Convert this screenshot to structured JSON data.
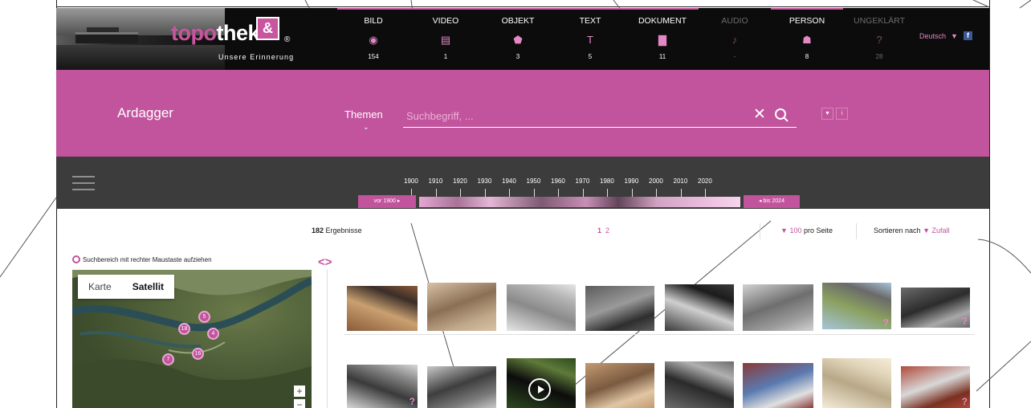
{
  "brand": {
    "word_a": "topo",
    "word_b": "thek",
    "mark": "&",
    "registered": "®",
    "tagline": "Unsere Erinnerung"
  },
  "categories": [
    {
      "label": "BILD",
      "icon": "image-icon",
      "glyph": "◉",
      "count": "154",
      "active": true
    },
    {
      "label": "VIDEO",
      "icon": "video-icon",
      "glyph": "▤",
      "count": "1",
      "active": true
    },
    {
      "label": "OBJEKT",
      "icon": "object-icon",
      "glyph": "⬟",
      "count": "3",
      "active": true
    },
    {
      "label": "TEXT",
      "icon": "text-icon",
      "glyph": "T",
      "count": "5",
      "active": true
    },
    {
      "label": "DOKUMENT",
      "icon": "document-icon",
      "glyph": "▇",
      "count": "11",
      "active": true
    },
    {
      "label": "AUDIO",
      "icon": "audio-icon",
      "glyph": "♪",
      "count": "-",
      "active": false
    },
    {
      "label": "PERSON",
      "icon": "person-icon",
      "glyph": "☗",
      "count": "8",
      "active": true
    },
    {
      "label": "UNGEKLÄRT",
      "icon": "question-icon",
      "glyph": "?",
      "count": "28",
      "active": false
    }
  ],
  "language": {
    "label": "Deutsch",
    "arrow": "▼"
  },
  "facebook": "f",
  "search": {
    "place": "Ardagger",
    "themen_label": "Themen",
    "themen_chevron": "⌄",
    "placeholder": "Suchbegriff, ...",
    "clear": "✕",
    "dropdown_btn": "▼",
    "info_btn": "i"
  },
  "timeline": {
    "years": [
      "1900",
      "1910",
      "1920",
      "1930",
      "1940",
      "1950",
      "1960",
      "1970",
      "1980",
      "1990",
      "2000",
      "2010",
      "2020"
    ],
    "start_label": "vor 1900",
    "end_label": "bis 2024"
  },
  "results": {
    "count": "182",
    "count_label": "Ergebnisse",
    "pages": [
      "1",
      "2"
    ],
    "current_page": "1",
    "per_page_arrow": "▼",
    "per_page_value": "100",
    "per_page_label": "pro Seite",
    "sort_label": "Sortieren nach",
    "sort_arrow": "▼",
    "sort_value": "Zufall"
  },
  "map": {
    "hint": "Suchbereich mit rechter Maustaste aufziehen",
    "toggle": "<>",
    "type_options": [
      "Karte",
      "Satellit"
    ],
    "selected_type": "Satellit",
    "clusters": [
      "5",
      "18",
      "4",
      "16",
      "7"
    ],
    "zoom_in": "+",
    "zoom_out": "−"
  },
  "thumbnails": {
    "row1": [
      {
        "name": "thumb-group-work-scene",
        "colors": [
          "#8a5a3a",
          "#c9a070",
          "#3a2e28"
        ]
      },
      {
        "name": "thumb-sepia-yard",
        "colors": [
          "#d8c2a4",
          "#8b6f55",
          "#bfa78a"
        ]
      },
      {
        "name": "thumb-street-village",
        "colors": [
          "#e6e6e6",
          "#8a8a8a",
          "#b4b4b4"
        ]
      },
      {
        "name": "thumb-aerial-view",
        "colors": [
          "#5c5c5c",
          "#9a9a9a",
          "#2e2e2e"
        ]
      },
      {
        "name": "thumb-house-trees",
        "colors": [
          "#3a3a3a",
          "#cfcfcf",
          "#1c1c1c"
        ]
      },
      {
        "name": "thumb-church-postcard",
        "colors": [
          "#d2d2d2",
          "#6e6e6e",
          "#9c9c9c"
        ]
      },
      {
        "name": "thumb-wayside-shrine",
        "colors": [
          "#a7c4d9",
          "#8aa060",
          "#6a6a6a"
        ],
        "unresolved": true
      },
      {
        "name": "thumb-group-photo-bw",
        "colors": [
          "#6a6a6a",
          "#2c2c2c",
          "#a8a8a8"
        ],
        "unresolved": true
      }
    ],
    "row2": [
      {
        "name": "thumb-wedding-group",
        "colors": [
          "#d8d8d8",
          "#3a3a3a",
          "#8a8a8a"
        ],
        "unresolved": true
      },
      {
        "name": "thumb-men-group",
        "colors": [
          "#c8c8c8",
          "#3e3e3e",
          "#7a7a7a"
        ]
      },
      {
        "name": "thumb-video-forest",
        "colors": [
          "#2e4a1e",
          "#0c0c0c",
          "#5e7a3a"
        ],
        "video": true
      },
      {
        "name": "thumb-tractor-sepia",
        "colors": [
          "#c49a72",
          "#7a5a40",
          "#e0c6a4"
        ]
      },
      {
        "name": "thumb-interior-bw",
        "colors": [
          "#6c6c6c",
          "#2a2a2a",
          "#b0b0b0"
        ]
      },
      {
        "name": "thumb-band-group",
        "colors": [
          "#8a3a3a",
          "#5a7ab0",
          "#e0e0e0"
        ]
      },
      {
        "name": "thumb-document-page",
        "colors": [
          "#f4ecd8",
          "#b8a888",
          "#e2d6ba"
        ]
      },
      {
        "name": "thumb-festival-group",
        "colors": [
          "#b04a3a",
          "#d8d8d8",
          "#7a3020"
        ],
        "unresolved": true
      }
    ],
    "unresolved_mark": "?"
  }
}
